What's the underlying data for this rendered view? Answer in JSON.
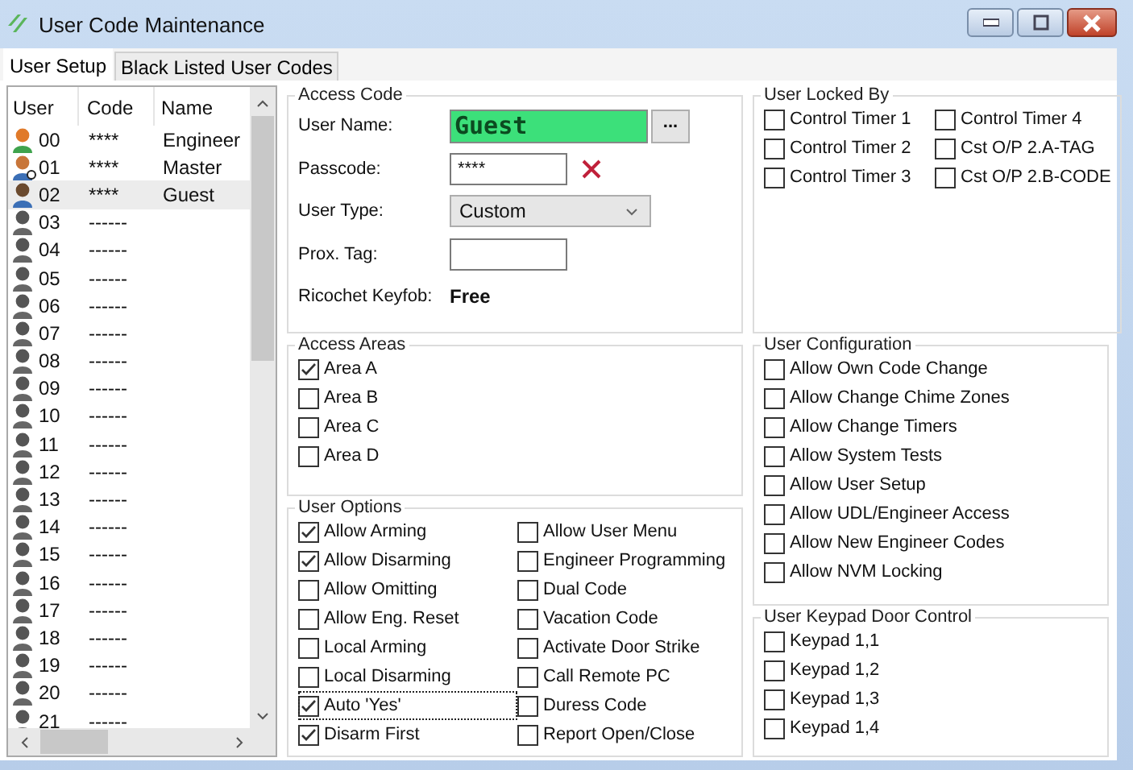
{
  "window": {
    "title": "User Code Maintenance"
  },
  "tabs": [
    {
      "label": "User Setup",
      "selected": true
    },
    {
      "label": "Black Listed User Codes",
      "selected": false
    }
  ],
  "user_list": {
    "columns": [
      "User",
      "Code",
      "Name"
    ],
    "rows": [
      {
        "user": "00",
        "code": "****",
        "name": "Engineer",
        "kind": "engineer",
        "selected": false
      },
      {
        "user": "01",
        "code": "****",
        "name": "Master",
        "kind": "master",
        "selected": false
      },
      {
        "user": "02",
        "code": "****",
        "name": "Guest",
        "kind": "guest",
        "selected": true
      },
      {
        "user": "03",
        "code": "------",
        "kind": "empty",
        "selected": false
      },
      {
        "user": "04",
        "code": "------",
        "kind": "empty",
        "selected": false
      },
      {
        "user": "05",
        "code": "------",
        "kind": "empty",
        "selected": false
      },
      {
        "user": "06",
        "code": "------",
        "kind": "empty",
        "selected": false
      },
      {
        "user": "07",
        "code": "------",
        "kind": "empty",
        "selected": false
      },
      {
        "user": "08",
        "code": "------",
        "kind": "empty",
        "selected": false
      },
      {
        "user": "09",
        "code": "------",
        "kind": "empty",
        "selected": false
      },
      {
        "user": "10",
        "code": "------",
        "kind": "empty",
        "selected": false
      },
      {
        "user": "11",
        "code": "------",
        "kind": "empty",
        "selected": false
      },
      {
        "user": "12",
        "code": "------",
        "kind": "empty",
        "selected": false
      },
      {
        "user": "13",
        "code": "------",
        "kind": "empty",
        "selected": false
      },
      {
        "user": "14",
        "code": "------",
        "kind": "empty",
        "selected": false
      },
      {
        "user": "15",
        "code": "------",
        "kind": "empty",
        "selected": false
      },
      {
        "user": "16",
        "code": "------",
        "kind": "empty",
        "selected": false
      },
      {
        "user": "17",
        "code": "------",
        "kind": "empty",
        "selected": false
      },
      {
        "user": "18",
        "code": "------",
        "kind": "empty",
        "selected": false
      },
      {
        "user": "19",
        "code": "------",
        "kind": "empty",
        "selected": false
      },
      {
        "user": "20",
        "code": "------",
        "kind": "empty",
        "selected": false
      },
      {
        "user": "21",
        "code": "------",
        "kind": "empty",
        "selected": false
      }
    ]
  },
  "access_code": {
    "title": "Access Code",
    "user_name_label": "User Name:",
    "user_name": "Guest",
    "browse_button": "...",
    "passcode_label": "Passcode:",
    "passcode": "****",
    "user_type_label": "User Type:",
    "user_type": "Custom",
    "prox_tag_label": "Prox. Tag:",
    "keyfob_label": "Ricochet Keyfob:",
    "keyfob": "Free"
  },
  "user_locked_by": {
    "title": "User Locked By",
    "items": [
      {
        "label": "Control Timer 1",
        "checked": false
      },
      {
        "label": "Control Timer 4",
        "checked": false
      },
      {
        "label": "Control Timer 2",
        "checked": false
      },
      {
        "label": "Cst O/P 2.A-TAG",
        "checked": false
      },
      {
        "label": "Control Timer 3",
        "checked": false
      },
      {
        "label": "Cst O/P 2.B-CODE",
        "checked": false
      }
    ]
  },
  "access_areas": {
    "title": "Access Areas",
    "items": [
      {
        "label": "Area A",
        "checked": true
      },
      {
        "label": "Area B",
        "checked": false
      },
      {
        "label": "Area C",
        "checked": false
      },
      {
        "label": "Area D",
        "checked": false
      }
    ]
  },
  "user_configuration": {
    "title": "User Configuration",
    "items": [
      {
        "label": "Allow Own Code Change",
        "checked": false
      },
      {
        "label": "Allow Change Chime Zones",
        "checked": false
      },
      {
        "label": "Allow Change Timers",
        "checked": false
      },
      {
        "label": "Allow System Tests",
        "checked": false
      },
      {
        "label": "Allow User Setup",
        "checked": false
      },
      {
        "label": "Allow UDL/Engineer Access",
        "checked": false
      },
      {
        "label": "Allow New Engineer Codes",
        "checked": false
      },
      {
        "label": "Allow NVM Locking",
        "checked": false
      }
    ]
  },
  "user_options": {
    "title": "User Options",
    "items": [
      {
        "label": "Allow Arming",
        "checked": true,
        "focused": false
      },
      {
        "label": "Allow User Menu",
        "checked": false,
        "focused": false
      },
      {
        "label": "Allow Disarming",
        "checked": true,
        "focused": false
      },
      {
        "label": "Engineer Programming",
        "checked": false,
        "focused": false
      },
      {
        "label": "Allow Omitting",
        "checked": false,
        "focused": false
      },
      {
        "label": "Dual Code",
        "checked": false,
        "focused": false
      },
      {
        "label": "Allow Eng. Reset",
        "checked": false,
        "focused": false
      },
      {
        "label": "Vacation Code",
        "checked": false,
        "focused": false
      },
      {
        "label": "Local Arming",
        "checked": false,
        "focused": false
      },
      {
        "label": "Activate Door Strike",
        "checked": false,
        "focused": false
      },
      {
        "label": "Local Disarming",
        "checked": false,
        "focused": false
      },
      {
        "label": "Call Remote PC",
        "checked": false,
        "focused": false
      },
      {
        "label": "Auto 'Yes'",
        "checked": true,
        "focused": true
      },
      {
        "label": "Duress Code",
        "checked": false,
        "focused": false
      },
      {
        "label": "Disarm First",
        "checked": true,
        "focused": false
      },
      {
        "label": "Report Open/Close",
        "checked": false,
        "focused": false
      }
    ]
  },
  "keypad_door_control": {
    "title": "User Keypad Door Control",
    "items": [
      {
        "label": "Keypad 1,1",
        "checked": false
      },
      {
        "label": "Keypad 1,2",
        "checked": false
      },
      {
        "label": "Keypad 1,3",
        "checked": false
      },
      {
        "label": "Keypad 1,4",
        "checked": false
      }
    ]
  }
}
